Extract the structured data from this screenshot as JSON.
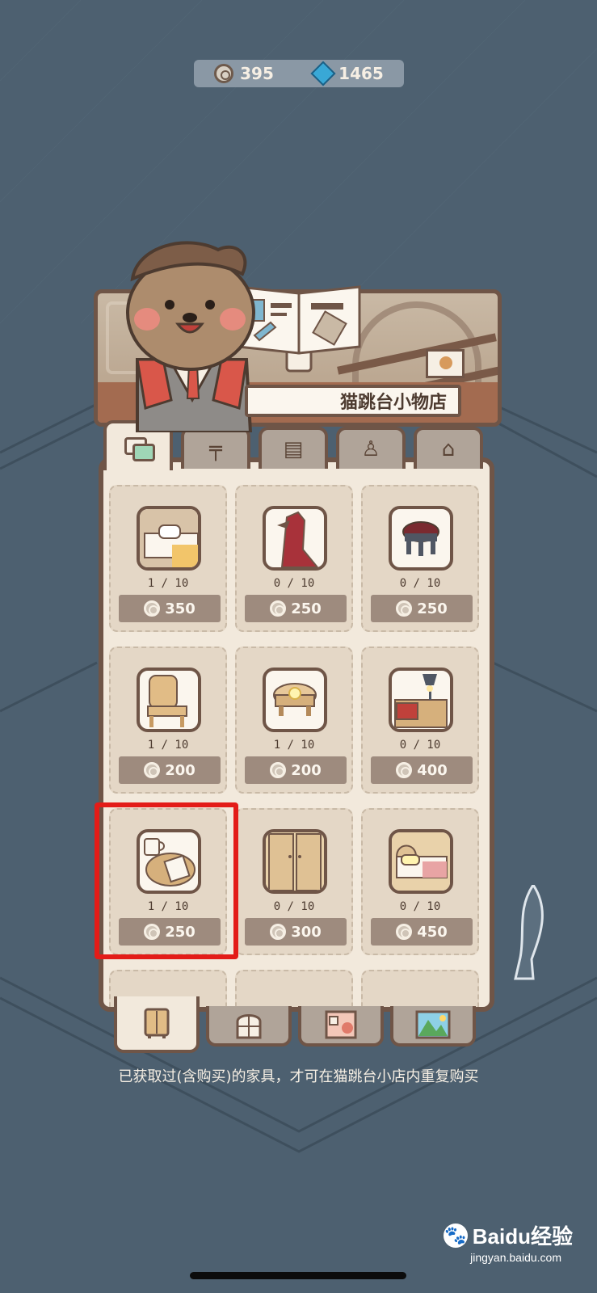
{
  "currency": {
    "coins": "395",
    "gems": "1465"
  },
  "shop": {
    "title": "猫跳台小物店"
  },
  "category_tabs": [
    {
      "name": "all",
      "active": true
    },
    {
      "name": "table",
      "glyph": "╤"
    },
    {
      "name": "cabinet",
      "glyph": "▤"
    },
    {
      "name": "chair",
      "glyph": "♙"
    },
    {
      "name": "bed",
      "glyph": "⌂"
    }
  ],
  "items": [
    {
      "name": "bed",
      "count": "1 / 10",
      "price": "350"
    },
    {
      "name": "cat-tower",
      "count": "0 / 10",
      "price": "250"
    },
    {
      "name": "round-stool",
      "count": "0 / 10",
      "price": "250"
    },
    {
      "name": "wooden-chair",
      "count": "1 / 10",
      "price": "200"
    },
    {
      "name": "flower-table",
      "count": "1 / 10",
      "price": "200"
    },
    {
      "name": "lamp-desk",
      "count": "0 / 10",
      "price": "400"
    },
    {
      "name": "coffee-table",
      "count": "1 / 10",
      "price": "250"
    },
    {
      "name": "wardrobe",
      "count": "0 / 10",
      "price": "300"
    },
    {
      "name": "small-bed",
      "count": "0 / 10",
      "price": "450"
    }
  ],
  "bottom_tabs": [
    {
      "name": "furniture",
      "active": true
    },
    {
      "name": "window"
    },
    {
      "name": "wallpaper"
    },
    {
      "name": "scenery"
    }
  ],
  "note": "已获取过(含购买)的家具，才可在猫跳台小店内重复购买",
  "watermark": {
    "brand": "Baidu经验",
    "site": "jingyan.baidu.com"
  },
  "colors": {
    "background": "#4d6070",
    "panel": "#f2e9dc",
    "border": "#6f5547",
    "price_bg": "#9e8b7e",
    "highlight": "#e31c18"
  }
}
